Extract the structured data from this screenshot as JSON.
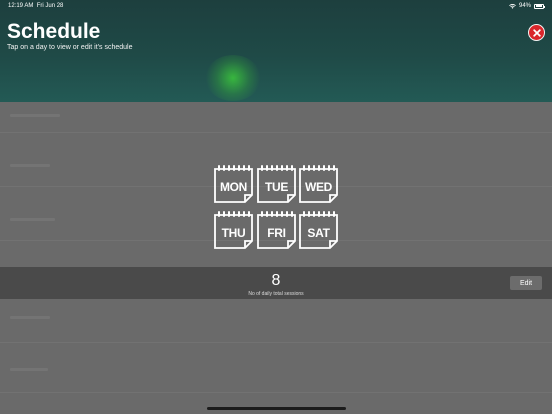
{
  "status_bar": {
    "time": "12:19 AM",
    "date": "Fri Jun 28",
    "battery_percent": "94%",
    "battery_level": 0.94
  },
  "header": {
    "title": "Schedule",
    "subtitle": "Tap on a day to view or edit it's schedule"
  },
  "days": [
    {
      "label": "MON"
    },
    {
      "label": "TUE"
    },
    {
      "label": "WED"
    },
    {
      "label": "THU"
    },
    {
      "label": "FRI"
    },
    {
      "label": "SAT"
    }
  ],
  "sessions": {
    "count": "8",
    "label": "No of daily total sessions",
    "edit_label": "Edit"
  },
  "colors": {
    "header_bg": "#1f4a47",
    "close_red": "#d9262b",
    "overlay_gray": "#6a6a6a",
    "sessions_bar": "#4a4a4a"
  },
  "icons": {
    "close": "close-icon",
    "day": "calendar-page-icon",
    "wifi": "wifi-icon",
    "battery": "battery-icon"
  }
}
